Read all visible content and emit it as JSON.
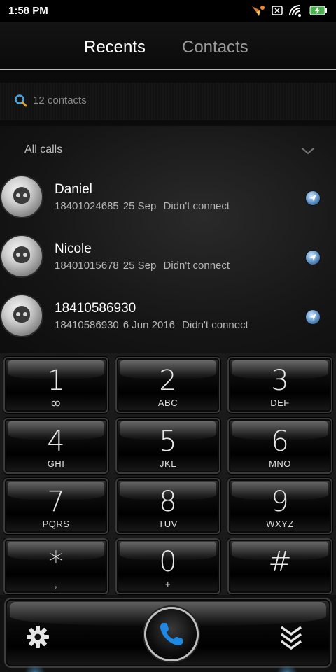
{
  "status_bar": {
    "time": "1:58 PM",
    "icons": [
      "notification-icon",
      "sim-icon",
      "wifi-icon",
      "battery-charging-icon"
    ]
  },
  "tabs": [
    {
      "label": "Recents",
      "active": true
    },
    {
      "label": "Contacts",
      "active": false
    }
  ],
  "search": {
    "placeholder": "12 contacts",
    "icon": "search-icon"
  },
  "call_filter": {
    "label": "All calls",
    "icon": "chevron-down-icon"
  },
  "calls": [
    {
      "name": "Daniel",
      "number": "18401024685",
      "date": "25 Sep",
      "status": "Didn't connect"
    },
    {
      "name": "Nicole",
      "number": "18401015678",
      "date": "25 Sep",
      "status": "Didn't connect"
    },
    {
      "name": "18410586930",
      "number": "18410586930",
      "date": "6 Jun 2016",
      "status": "Didn't connect"
    }
  ],
  "keypad": [
    {
      "digit": "1",
      "letters": "ꝏ"
    },
    {
      "digit": "2",
      "letters": "ABC"
    },
    {
      "digit": "3",
      "letters": "DEF"
    },
    {
      "digit": "4",
      "letters": "GHI"
    },
    {
      "digit": "5",
      "letters": "JKL"
    },
    {
      "digit": "6",
      "letters": "MNO"
    },
    {
      "digit": "7",
      "letters": "PQRS"
    },
    {
      "digit": "8",
      "letters": "TUV"
    },
    {
      "digit": "9",
      "letters": "WXYZ"
    },
    {
      "digit": "*",
      "letters": ","
    },
    {
      "digit": "0",
      "letters": "+"
    },
    {
      "digit": "#",
      "letters": ""
    }
  ],
  "actions": {
    "settings_icon": "gear-icon",
    "call_icon": "phone-icon",
    "collapse_icon": "chevron-double-down-icon"
  },
  "colors": {
    "accent": "#1e88e5",
    "battery": "#4caf50"
  }
}
